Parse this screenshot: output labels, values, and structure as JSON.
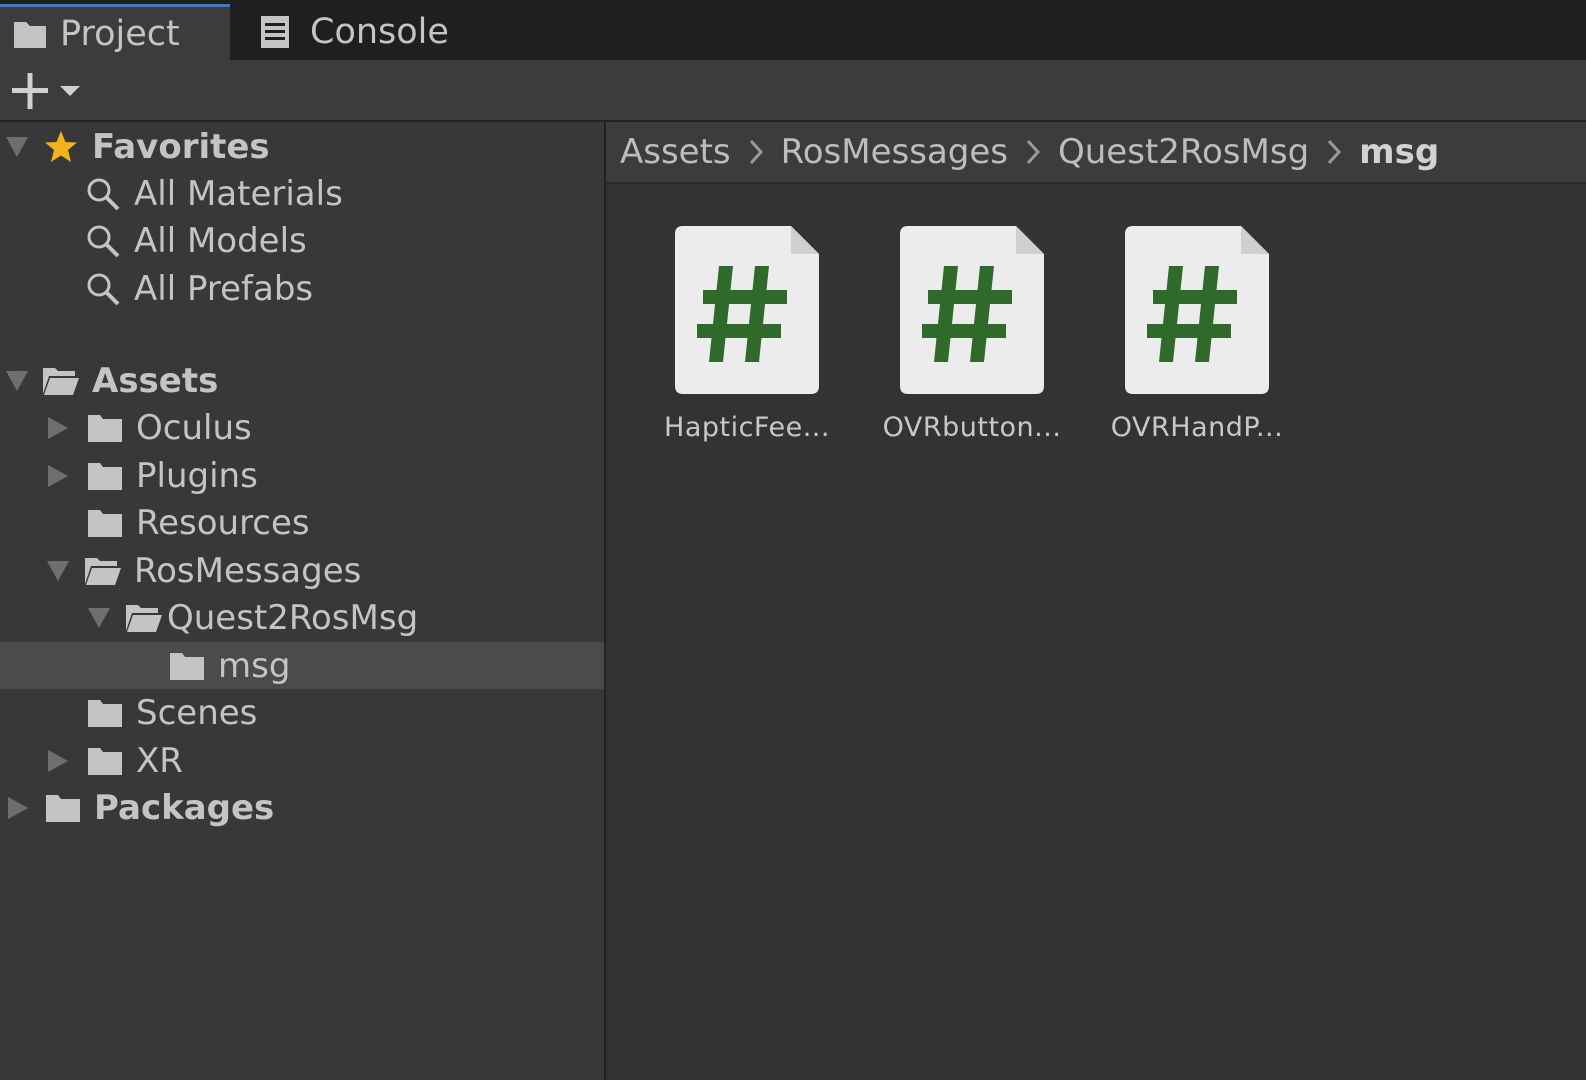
{
  "tabs": [
    {
      "label": "Project",
      "icon": "folder-icon",
      "active": true
    },
    {
      "label": "Console",
      "icon": "console-icon",
      "active": false
    }
  ],
  "toolbar": {
    "add_icon": "plus-icon",
    "dropdown_icon": "chevron-down-icon"
  },
  "tree": {
    "favorites": {
      "label": "Favorites",
      "icon": "star-icon"
    },
    "favorite_items": [
      {
        "label": "All Materials",
        "icon": "search-icon"
      },
      {
        "label": "All Models",
        "icon": "search-icon"
      },
      {
        "label": "All Prefabs",
        "icon": "search-icon"
      }
    ],
    "assets": {
      "label": "Assets",
      "icon": "folder-open-icon"
    },
    "folders": {
      "oculus": "Oculus",
      "plugins": "Plugins",
      "resources": "Resources",
      "rosmessages": "RosMessages",
      "quest2rosmsg": "Quest2RosMsg",
      "msg": "msg",
      "scenes": "Scenes",
      "xr": "XR"
    },
    "packages": {
      "label": "Packages",
      "icon": "folder-icon"
    },
    "selected": "msg"
  },
  "breadcrumb": [
    "Assets",
    "RosMessages",
    "Quest2RosMsg",
    "msg"
  ],
  "assets": [
    {
      "name": "HapticFee...",
      "icon": "csharp-script-icon"
    },
    {
      "name": "OVRbutton...",
      "icon": "csharp-script-icon"
    },
    {
      "name": "OVRHandP...",
      "icon": "csharp-script-icon"
    }
  ],
  "colors": {
    "accent_tab": "#3a7ad6",
    "script_hash": "#2f6a2b",
    "star": "#f2b21e"
  }
}
